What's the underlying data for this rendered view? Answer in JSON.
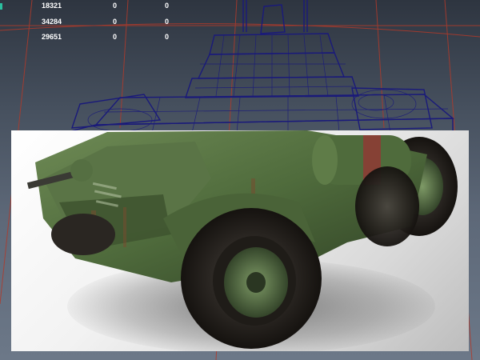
{
  "scene_stats": {
    "rows": [
      {
        "label": "",
        "values": [
          "18321",
          "0",
          "0"
        ]
      },
      {
        "label": "",
        "values": [
          "34284",
          "0",
          "0"
        ]
      },
      {
        "label": "",
        "values": [
          "29651",
          "0",
          "0"
        ]
      }
    ]
  },
  "colors": {
    "wireframe": "#1a1a7a",
    "grid_line": "#b23a2a",
    "vehicle_paint": "#4f6b3c",
    "tire": "#2a2622",
    "rust": "#7a4a2e",
    "stripe": "#8f3a34"
  },
  "icons": {
    "stats_marker": "cyan-bar"
  },
  "scene": {
    "wireframe_model": "armored-car-wireframe",
    "render_model": "armored-car-textured"
  }
}
